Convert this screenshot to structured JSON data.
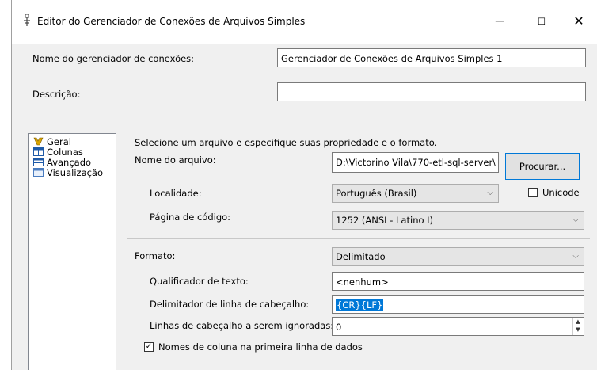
{
  "window": {
    "title": "Editor do Gerenciador de Conexões de Arquivos Simples",
    "minimize": "—",
    "maximize": "☐",
    "close": "✕"
  },
  "form": {
    "name_label": "Nome do gerenciador de conexões:",
    "name_value": "Gerenciador de Conexões de Arquivos Simples 1",
    "description_label": "Descrição:",
    "description_value": ""
  },
  "nav": {
    "items": [
      {
        "label": "Geral",
        "icon": "general-icon"
      },
      {
        "label": "Colunas",
        "icon": "columns-icon"
      },
      {
        "label": "Avançado",
        "icon": "advanced-icon"
      },
      {
        "label": "Visualização",
        "icon": "preview-icon"
      }
    ]
  },
  "general": {
    "instruction": "Selecione um arquivo e especifique suas propriedade e o formato.",
    "file_name_label": "Nome do arquivo:",
    "file_name_value": "D:\\Victorino Vila\\770-etl-sql-server\\",
    "browse_button": "Procurar...",
    "locale_label": "Localidade:",
    "locale_value": "Português (Brasil)",
    "unicode_label": "Unicode",
    "unicode_checked": false,
    "codepage_label": "Página de código:",
    "codepage_value": "1252  (ANSI - Latino I)",
    "format_label": "Formato:",
    "format_value": "Delimitado",
    "text_qualifier_label": "Qualificador de texto:",
    "text_qualifier_value": "<nenhum>",
    "header_row_delimiter_label": "Delimitador de linha de cabeçalho:",
    "header_row_delimiter_value": "{CR}{LF}",
    "header_rows_skip_label": "Linhas de cabeçalho a serem ignoradas:",
    "header_rows_skip_value": "0",
    "column_names_label": "Nomes de coluna na primeira linha de dados",
    "column_names_checked": true
  },
  "colors": {
    "selection": "#0078d7",
    "button_border": "#0078d7"
  }
}
